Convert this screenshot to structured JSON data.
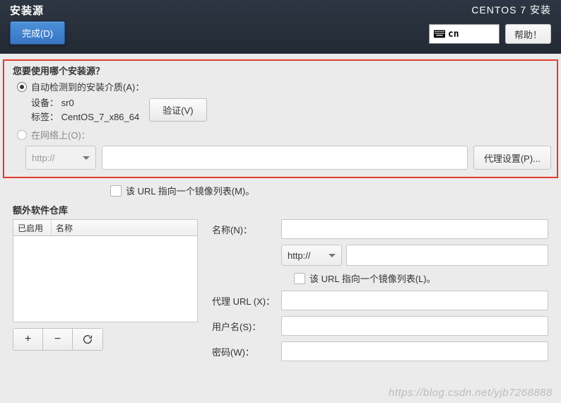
{
  "header": {
    "title": "安装源",
    "done_label": "完成(D)",
    "right_title": "CENTOS 7 安装",
    "lang": "cn",
    "help_label": "帮助！"
  },
  "source": {
    "question": "您要使用哪个安装源？",
    "auto_label": "自动检测到的安装介质(A)：",
    "device_label": "设备：",
    "device_value": "sr0",
    "tag_label": "标签：",
    "tag_value": "CentOS_7_x86_64",
    "verify_label": "验证(V)",
    "network_label": "在网络上(O)：",
    "scheme": "http://",
    "url_value": "",
    "proxy_label": "代理设置(P)...",
    "mirror_label": "该 URL 指向一个镜像列表(M)。"
  },
  "repo": {
    "title": "额外软件仓库",
    "th_enabled": "已启用",
    "th_name": "名称",
    "name_label": "名称(N)：",
    "scheme": "http://",
    "mirror_label": "该 URL 指向一个镜像列表(L)。",
    "proxy_url_label": "代理 URL (X)：",
    "user_label": "用户名(S)：",
    "pass_label": "密码(W)："
  },
  "watermark": "https://blog.csdn.net/yjb7268888"
}
